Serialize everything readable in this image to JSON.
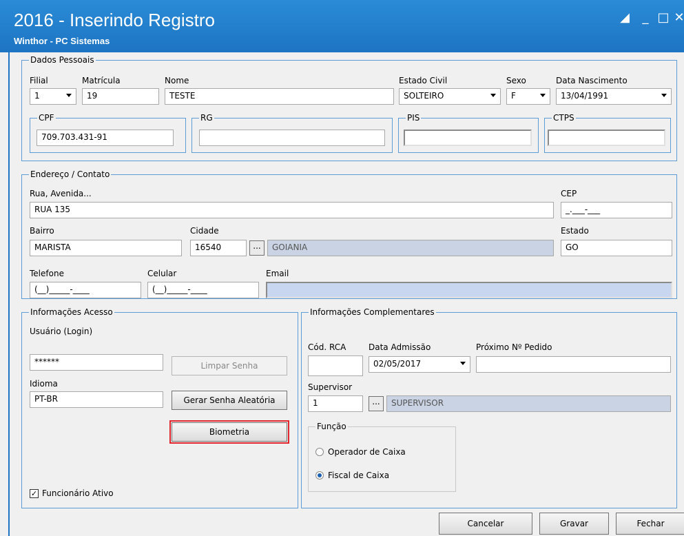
{
  "window": {
    "title": "2016 - Inserindo Registro",
    "subtitle": "Winthor - PC Sistemas"
  },
  "dados_pessoais": {
    "legend": "Dados Pessoais",
    "filial": {
      "label": "Filial",
      "value": "1"
    },
    "matricula": {
      "label": "Matrícula",
      "value": "19"
    },
    "nome": {
      "label": "Nome",
      "value": "TESTE"
    },
    "estado_civil": {
      "label": "Estado Civil",
      "value": "SOLTEIRO"
    },
    "sexo": {
      "label": "Sexo",
      "value": "F"
    },
    "data_nascimento": {
      "label": "Data Nascimento",
      "value": "13/04/1991"
    },
    "cpf": {
      "legend": "CPF",
      "value": "709.703.431-91"
    },
    "rg": {
      "legend": "RG",
      "value": ""
    },
    "pis": {
      "legend": "PIS",
      "value": ""
    },
    "ctps": {
      "legend": "CTPS",
      "value": ""
    }
  },
  "endereco": {
    "legend": "Endereço / Contato",
    "rua": {
      "label": "Rua, Avenida...",
      "value": "RUA 135"
    },
    "cep": {
      "label": "CEP",
      "value": "_.___-___"
    },
    "bairro": {
      "label": "Bairro",
      "value": "MARISTA"
    },
    "cidade": {
      "label": "Cidade",
      "code": "16540",
      "name": "GOIANIA",
      "button": "..."
    },
    "estado": {
      "label": "Estado",
      "value": "GO"
    },
    "telefone": {
      "label": "Telefone",
      "value": "(__)_____-____"
    },
    "celular": {
      "label": "Celular",
      "value": "(__)_____-____"
    },
    "email": {
      "label": "Email",
      "value": ""
    }
  },
  "acesso": {
    "legend": "Informações Acesso",
    "usuario": {
      "label": "Usuário (Login)",
      "value": "******"
    },
    "limpar_senha": "Limpar Senha",
    "idioma": {
      "label": "Idioma",
      "value": "PT-BR"
    },
    "gerar_senha": "Gerar Senha Aleatória",
    "biometria": "Biometria",
    "funcionario_ativo": {
      "label": "Funcionário Ativo",
      "checked": true
    }
  },
  "complementares": {
    "legend": "Informações Complementares",
    "cod_rca": {
      "label": "Cód. RCA",
      "value": ""
    },
    "data_admissao": {
      "label": "Data Admissão",
      "value": "02/05/2017"
    },
    "proximo_pedido": {
      "label": "Próximo Nº Pedido",
      "value": ""
    },
    "supervisor": {
      "label": "Supervisor",
      "code": "1",
      "name": "SUPERVISOR",
      "button": "..."
    },
    "funcao": {
      "legend": "Função",
      "options": [
        "Operador de Caixa",
        "Fiscal de Caixa"
      ],
      "selected": "Fiscal de Caixa"
    }
  },
  "footer": {
    "cancelar": "Cancelar",
    "gravar": "Gravar",
    "fechar": "Fechar"
  }
}
